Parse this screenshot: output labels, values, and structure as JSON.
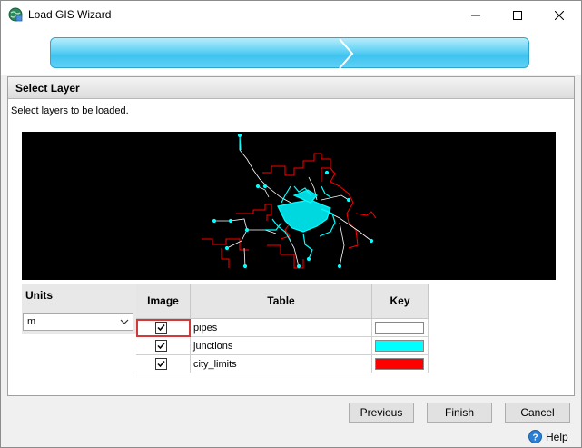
{
  "window": {
    "title": "Load GIS Wizard"
  },
  "panel": {
    "title": "Select Layer",
    "description": "Select layers to be loaded."
  },
  "units": {
    "label": "Units",
    "selected": "m"
  },
  "grid": {
    "headers": {
      "image": "Image",
      "table": "Table",
      "key": "Key"
    },
    "rows": [
      {
        "checked": true,
        "table": "pipes",
        "key_color": "#ffffff"
      },
      {
        "checked": true,
        "table": "junctions",
        "key_color": "#00ffff"
      },
      {
        "checked": true,
        "table": "city_limits",
        "key_color": "#ff0000"
      }
    ]
  },
  "buttons": {
    "previous": "Previous",
    "finish": "Finish",
    "cancel": "Cancel",
    "help": "Help"
  },
  "icons": {
    "app": "globe-app-icon",
    "minimize": "minimize-icon",
    "maximize": "maximize-icon",
    "close": "close-icon",
    "help": "help-icon",
    "dropdown": "chevron-down-icon"
  },
  "colors": {
    "progress": "#3fc3f0",
    "map_background": "#000000",
    "pipes": "#ffffff",
    "junctions": "#00ffff",
    "city_limits": "#ff0000"
  }
}
